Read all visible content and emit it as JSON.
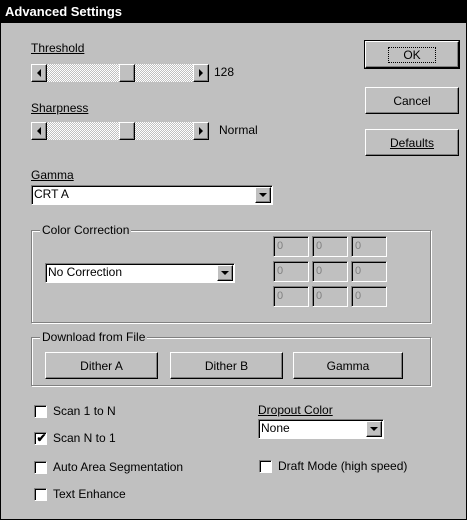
{
  "window": {
    "title": "Advanced Settings"
  },
  "threshold": {
    "label": "Threshold",
    "value": "128",
    "level": 0.55
  },
  "sharpness": {
    "label": "Sharpness",
    "value": "Normal",
    "level": 0.55
  },
  "buttons": {
    "ok": "OK",
    "cancel": "Cancel",
    "defaults": "Defaults"
  },
  "gamma": {
    "label": "Gamma",
    "selected": "CRT A"
  },
  "color_correction": {
    "title": "Color Correction",
    "selected": "No Correction",
    "matrix": [
      [
        "0",
        "0",
        "0"
      ],
      [
        "0",
        "0",
        "0"
      ],
      [
        "0",
        "0",
        "0"
      ]
    ]
  },
  "download": {
    "title": "Download from File",
    "buttons": [
      "Dither A",
      "Dither B",
      "Gamma"
    ]
  },
  "options": {
    "scan_1_to_n": {
      "label": "Scan 1 to N",
      "checked": false
    },
    "scan_n_to_1": {
      "label": "Scan N to 1",
      "checked": true
    },
    "auto_area": {
      "label": "Auto Area Segmentation",
      "checked": false
    },
    "text_enhance": {
      "label": "Text Enhance",
      "checked": false
    },
    "draft_mode": {
      "label": "Draft Mode (high speed)",
      "checked": false
    }
  },
  "dropout": {
    "label": "Dropout Color",
    "selected": "None"
  },
  "icons": {
    "scroll_left": "left-arrow-icon",
    "scroll_right": "right-arrow-icon",
    "dropdown": "down-arrow-icon",
    "check": "check-icon"
  }
}
